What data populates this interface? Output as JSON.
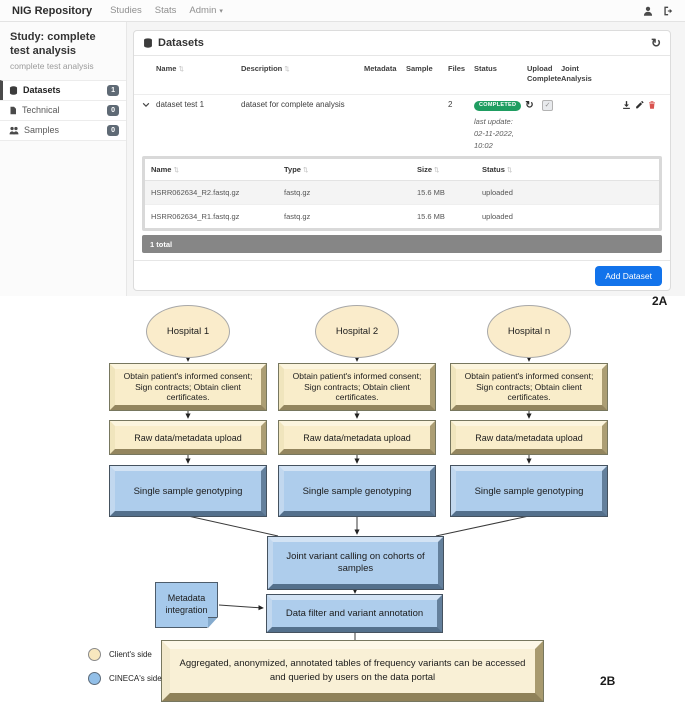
{
  "navbar": {
    "brand": "NIG Repository",
    "links": [
      "Studies",
      "Stats",
      "Admin"
    ]
  },
  "icons": {
    "sort": "⇅",
    "refresh": "↻",
    "caret": "▾",
    "check": "✓"
  },
  "sidebar": {
    "study_title": "Study: complete test analysis",
    "study_subtitle": "complete test analysis",
    "items": [
      {
        "label": "Datasets",
        "badge": "1",
        "icon": "database-icon",
        "active": true
      },
      {
        "label": "Technical",
        "badge": "0",
        "icon": "file-icon",
        "active": false
      },
      {
        "label": "Samples",
        "badge": "0",
        "icon": "users-icon",
        "active": false
      }
    ]
  },
  "panel": {
    "title": "Datasets",
    "columns": [
      "Name",
      "Description",
      "Metadata",
      "Sample",
      "Files",
      "Status",
      "Upload Complete",
      "Joint Analysis"
    ],
    "row": {
      "name": "dataset test 1",
      "description": "dataset for complete analysis",
      "files": "2",
      "status": "COMPLETED",
      "last_update": [
        "last update:",
        "02-11-2022,",
        "10:02"
      ]
    },
    "files_table": {
      "columns": [
        "Name",
        "Type",
        "Size",
        "Status"
      ],
      "rows": [
        [
          "HSRR062634_R2.fastq.gz",
          "fastq.gz",
          "15.6 MB",
          "uploaded"
        ],
        [
          "HSRR062634_R1.fastq.gz",
          "fastq.gz",
          "15.6 MB",
          "uploaded"
        ]
      ],
      "footer": "1 total"
    },
    "add_button": "Add Dataset"
  },
  "figure_labels": {
    "a": "2A",
    "b": "2B"
  },
  "flowchart": {
    "hospitals": [
      "Hospital 1",
      "Hospital 2",
      "Hospital n"
    ],
    "consent": "Obtain patient's informed consent; Sign contracts; Obtain client certificates.",
    "upload": "Raw data/metadata upload",
    "genotyping": "Single sample genotyping",
    "joint": "Joint variant calling on cohorts of samples",
    "metadata_note": "Metadata integration",
    "filter": "Data filter and variant annotation",
    "aggregated": "Aggregated, anonymized, annotated tables of frequency variants can be accessed and queried by users on the data portal",
    "legend": [
      {
        "label": "Client's side",
        "color": "#f8e8bf"
      },
      {
        "label": "CINECA's side",
        "color": "#92bfe8"
      }
    ]
  },
  "colors": {
    "accent_blue": "#1273eb",
    "success_green": "#1f9d61",
    "danger_red": "#d9534f",
    "client_fill": "#f9edca",
    "cineca_fill": "#aecdec"
  }
}
